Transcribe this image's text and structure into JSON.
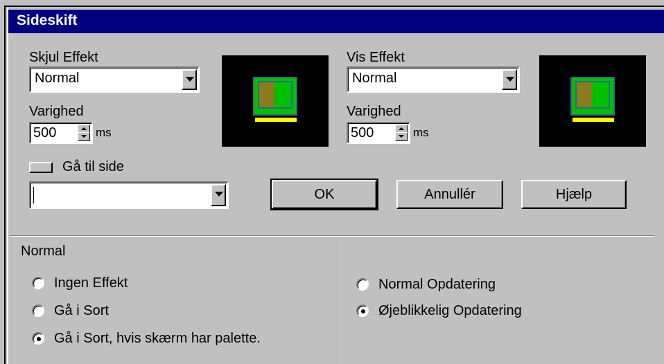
{
  "dialog": {
    "title": "Sideskift"
  },
  "hide_effect": {
    "label": "Skjul Effekt",
    "value": "Normal",
    "duration_label": "Varighed",
    "duration": "500",
    "unit": "ms"
  },
  "show_effect": {
    "label": "Vis Effekt",
    "value": "Normal",
    "duration_label": "Varighed",
    "duration": "500",
    "unit": "ms"
  },
  "goto_page": {
    "label": "Gå til side",
    "value": ""
  },
  "buttons": {
    "ok": "OK",
    "cancel": "Annullér",
    "help": "Hjælp"
  },
  "normal_group": {
    "title": "Normal",
    "options": [
      "Ingen Effekt",
      "Gå i Sort",
      "Gå i Sort, hvis skærm har palette."
    ],
    "selected_index": 2
  },
  "update_group": {
    "options": [
      "Normal Opdatering",
      "Øjeblikkelig Opdatering"
    ],
    "selected_index": 1
  },
  "colors": {
    "titlebar": "#000080",
    "face": "#c0c0c0",
    "preview_bg": "#000000",
    "preview_green": "#00c000",
    "preview_yellow": "#ffff00"
  }
}
